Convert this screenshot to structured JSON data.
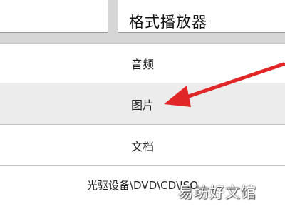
{
  "top_buttons": {
    "right_label": "格式播放器"
  },
  "list": {
    "items": [
      {
        "label": "音频"
      },
      {
        "label": "图片"
      },
      {
        "label": "文档"
      },
      {
        "label": "光驱设备\\DVD\\CD\\ISO"
      }
    ]
  },
  "colors": {
    "arrow": "#e02626",
    "background": "#d6d6d6",
    "row": "#ffffff",
    "selected_row": "#ececec"
  },
  "watermark": {
    "text": "易坊好文馆"
  }
}
